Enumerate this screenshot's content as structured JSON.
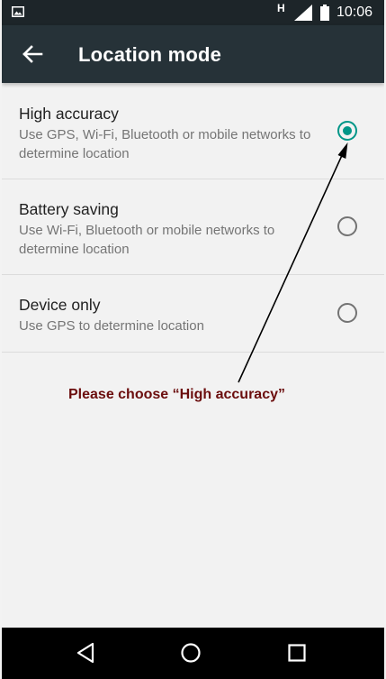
{
  "status_bar": {
    "time": "10:06",
    "network_type": "H",
    "icons": [
      "image-notification-icon",
      "signal-icon",
      "battery-icon"
    ]
  },
  "toolbar": {
    "back_icon": "arrow-left-icon",
    "title": "Location mode"
  },
  "options": [
    {
      "label": "High accuracy",
      "description": "Use GPS, Wi-Fi, Bluetooth or mobile networks to determine location",
      "selected": true
    },
    {
      "label": "Battery saving",
      "description": "Use Wi-Fi, Bluetooth or mobile networks to determine location",
      "selected": false
    },
    {
      "label": "Device only",
      "description": "Use GPS to determine location",
      "selected": false
    }
  ],
  "annotation": {
    "text": "Please choose “High accuracy”",
    "color": "#6b0d0d"
  },
  "nav_bar": {
    "buttons": [
      "back-triangle-icon",
      "home-circle-icon",
      "recents-square-icon"
    ]
  },
  "colors": {
    "accent": "#009688",
    "toolbar": "#263238",
    "status_bar": "#1d2529"
  }
}
